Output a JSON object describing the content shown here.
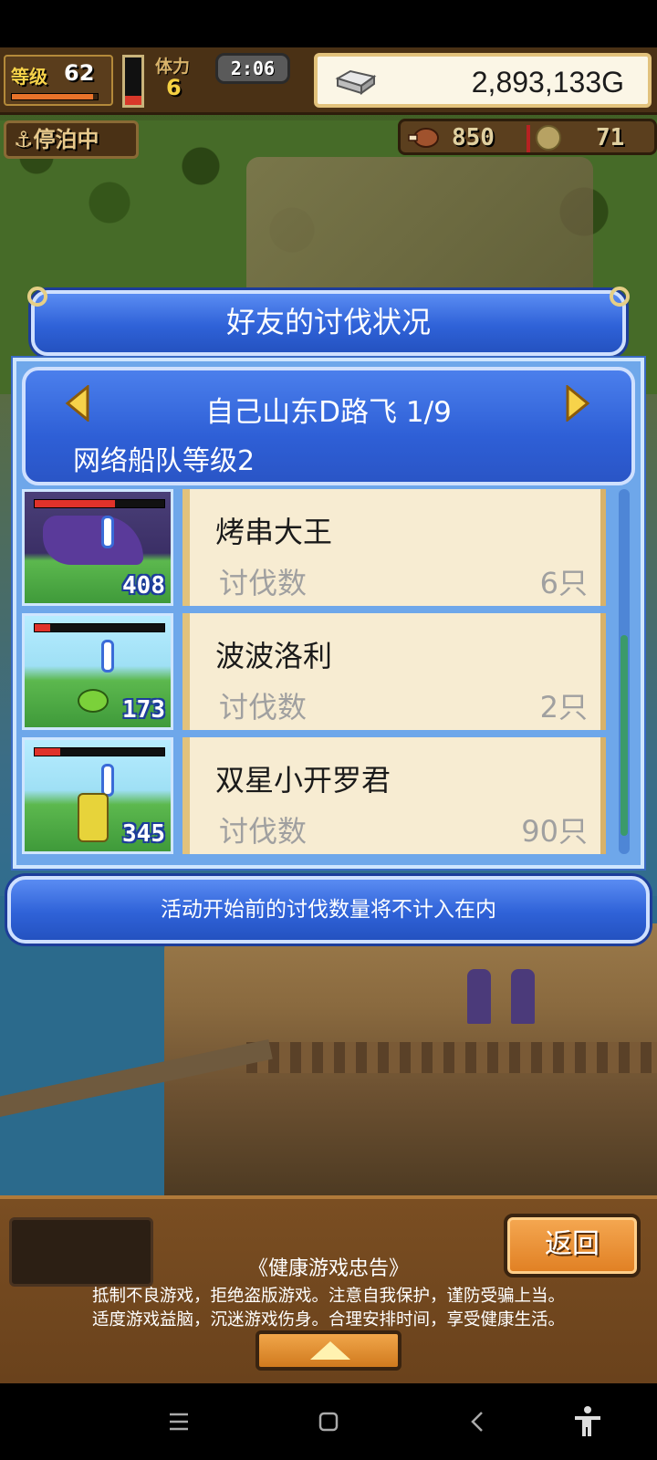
{
  "hud": {
    "level_label": "等级",
    "level_value": "62",
    "level_progress": 0.95,
    "stamina_label": "体力",
    "stamina_value": "6",
    "stamina_gauge_fill": 0.2,
    "timer": "2:06",
    "gold": "2,893,133G",
    "harbor_status": "停泊中",
    "food": "850",
    "medals": "71"
  },
  "dialog": {
    "title": "好友的讨伐状况",
    "friend": {
      "name": "自己山东D路飞 1/9",
      "fleet_level": "网络船队等级2"
    },
    "entries": [
      {
        "name": "烤串大王",
        "stat_label": "讨伐数",
        "stat_value": "6只",
        "thumb_count": "408",
        "thumb_hp": 0.62
      },
      {
        "name": "波波洛利",
        "stat_label": "讨伐数",
        "stat_value": "2只",
        "thumb_count": "173",
        "thumb_hp": 0.12
      },
      {
        "name": "双星小开罗君",
        "stat_label": "讨伐数",
        "stat_value": "90只",
        "thumb_count": "345",
        "thumb_hp": 0.2
      }
    ],
    "notice": "活动开始前的讨伐数量将不计入在内"
  },
  "bottom": {
    "back_label": "返回",
    "advice_title": "《健康游戏忠告》",
    "advice_line1": "抵制不良游戏，拒绝盗版游戏。注意自我保护，谨防受骗上当。",
    "advice_line2": "适度游戏益脑，沉迷游戏伤身。合理安排时间，享受健康生活。"
  },
  "colors": {
    "dialog_blue": "#2f62d8",
    "card_beige": "#f7ecd2",
    "hp_red": "#e0322a",
    "button_orange": "#e07f22"
  },
  "icons": {
    "arrow_left": "chevron-left-icon",
    "arrow_right": "chevron-right-icon",
    "anchor": "anchor-icon",
    "silver": "silver-bar-icon",
    "meat": "meat-icon",
    "medal": "medal-icon"
  }
}
